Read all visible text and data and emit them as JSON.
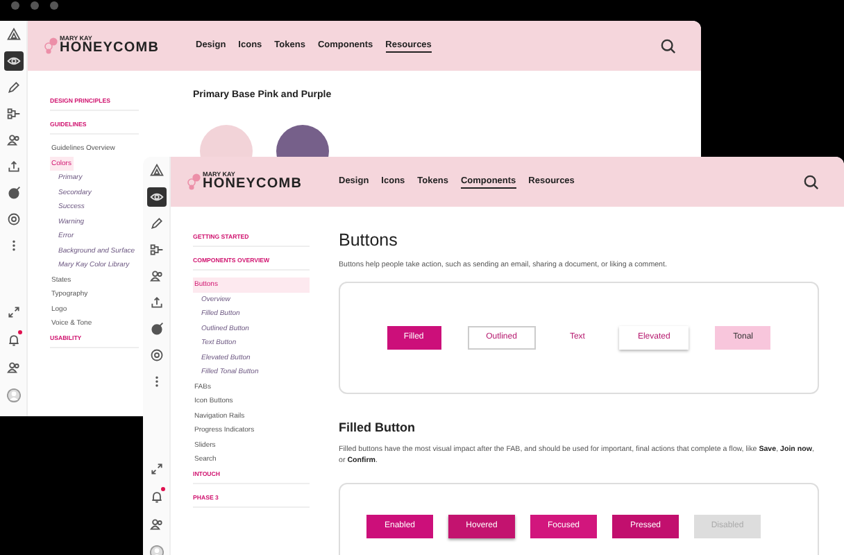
{
  "windows": [
    {
      "rail": {
        "top": [
          {
            "kind": "logo",
            "selected": false,
            "badge": false
          },
          {
            "kind": "eye",
            "selected": true,
            "badge": false
          },
          {
            "kind": "pencil",
            "selected": false,
            "badge": false
          },
          {
            "kind": "flow",
            "selected": false,
            "badge": false
          },
          {
            "kind": "people",
            "selected": false,
            "badge": false
          },
          {
            "kind": "upload",
            "selected": false,
            "badge": false
          },
          {
            "kind": "target",
            "selected": false,
            "badge": false
          },
          {
            "kind": "gear",
            "selected": false,
            "badge": false
          },
          {
            "kind": "more",
            "selected": false,
            "badge": false
          }
        ],
        "bottom": [
          {
            "kind": "expand",
            "selected": false,
            "badge": false
          },
          {
            "kind": "bell",
            "selected": false,
            "badge": true
          },
          {
            "kind": "people",
            "selected": false,
            "badge": false
          },
          {
            "kind": "avatar",
            "selected": false,
            "badge": false
          }
        ]
      },
      "logo": {
        "brand": "MARY KAY",
        "name": "HONEYCOMB"
      },
      "nav": [
        {
          "label": "Design",
          "selected": false
        },
        {
          "label": "Icons",
          "selected": false
        },
        {
          "label": "Tokens",
          "selected": false
        },
        {
          "label": "Components",
          "selected": false
        },
        {
          "label": "Resources",
          "selected": true
        }
      ],
      "sidebar": [
        {
          "kind": "heading",
          "label": "DESIGN PRINCIPLES",
          "selected": false
        },
        {
          "kind": "heading",
          "label": "GUIDELINES",
          "selected": false
        },
        {
          "kind": "item",
          "label": "Guidelines Overview",
          "selected": false
        },
        {
          "kind": "item",
          "label": "Colors",
          "selected": true
        },
        {
          "kind": "subitem",
          "label": "Primary",
          "selected": false
        },
        {
          "kind": "subitem",
          "label": "Secondary",
          "selected": false
        },
        {
          "kind": "subitem",
          "label": "Success",
          "selected": false
        },
        {
          "kind": "subitem",
          "label": "Warning",
          "selected": false
        },
        {
          "kind": "subitem",
          "label": "Error",
          "selected": false
        },
        {
          "kind": "subitem",
          "label": "Background and Surface",
          "selected": false
        },
        {
          "kind": "subitem",
          "label": "Mary Kay Color Library",
          "selected": false
        },
        {
          "kind": "item",
          "label": "States",
          "selected": false
        },
        {
          "kind": "item",
          "label": "Typography",
          "selected": false
        },
        {
          "kind": "item",
          "label": "Logo",
          "selected": false
        },
        {
          "kind": "item",
          "label": "Voice & Tone",
          "selected": false
        },
        {
          "kind": "heading",
          "label": "USABILITY",
          "selected": false
        }
      ],
      "content": {
        "kind": "swatches",
        "title": "Primary  Base Pink and Purple",
        "swatches": [
          {
            "color": "#f2d3d8"
          },
          {
            "color": "#76608a"
          }
        ]
      }
    },
    {
      "rail": {
        "top": [
          {
            "kind": "logo",
            "selected": false,
            "badge": false
          },
          {
            "kind": "eye",
            "selected": true,
            "badge": false
          },
          {
            "kind": "pencil",
            "selected": false,
            "badge": false
          },
          {
            "kind": "flow",
            "selected": false,
            "badge": false
          },
          {
            "kind": "people",
            "selected": false,
            "badge": false
          },
          {
            "kind": "upload",
            "selected": false,
            "badge": false
          },
          {
            "kind": "target",
            "selected": false,
            "badge": false
          },
          {
            "kind": "gear",
            "selected": false,
            "badge": false
          },
          {
            "kind": "more",
            "selected": false,
            "badge": false
          }
        ],
        "bottom": [
          {
            "kind": "expand",
            "selected": false,
            "badge": false
          },
          {
            "kind": "bell",
            "selected": false,
            "badge": true
          },
          {
            "kind": "people",
            "selected": false,
            "badge": false
          },
          {
            "kind": "avatar",
            "selected": false,
            "badge": false
          }
        ]
      },
      "logo": {
        "brand": "MARY KAY",
        "name": "HONEYCOMB"
      },
      "nav": [
        {
          "label": "Design",
          "selected": false
        },
        {
          "label": "Icons",
          "selected": false
        },
        {
          "label": "Tokens",
          "selected": false
        },
        {
          "label": "Components",
          "selected": true
        },
        {
          "label": "Resources",
          "selected": false
        }
      ],
      "sidebar": [
        {
          "kind": "heading",
          "label": "GETTING STARTED",
          "selected": false
        },
        {
          "kind": "heading",
          "label": "COMPONENTS OVERVIEW",
          "selected": false
        },
        {
          "kind": "item",
          "label": "Buttons",
          "selected": true
        },
        {
          "kind": "subitem",
          "label": "Overview",
          "selected": false
        },
        {
          "kind": "subitem",
          "label": "Filled Button",
          "selected": false
        },
        {
          "kind": "subitem",
          "label": "Outlined Button",
          "selected": false
        },
        {
          "kind": "subitem",
          "label": "Text Button",
          "selected": false
        },
        {
          "kind": "subitem",
          "label": "Elevated Button",
          "selected": false
        },
        {
          "kind": "subitem",
          "label": "Filled Tonal Button",
          "selected": false
        },
        {
          "kind": "item",
          "label": "FABs",
          "selected": false
        },
        {
          "kind": "item",
          "label": "Icon Buttons",
          "selected": false
        },
        {
          "kind": "item",
          "label": "Navigation Rails",
          "selected": false
        },
        {
          "kind": "item",
          "label": "Progress Indicators",
          "selected": false
        },
        {
          "kind": "item",
          "label": "Sliders",
          "selected": false
        },
        {
          "kind": "item",
          "label": "Search",
          "selected": false
        },
        {
          "kind": "heading",
          "label": "INTOUCH",
          "selected": false
        },
        {
          "kind": "heading",
          "label": "PHASE 3",
          "selected": false
        }
      ],
      "content": {
        "kind": "buttons",
        "title": "Buttons",
        "description": "Buttons help people take action, such as sending an email, sharing a document, or liking a comment.",
        "variants": [
          {
            "label": "Filled",
            "kind": "filled"
          },
          {
            "label": "Outlined",
            "kind": "outlined"
          },
          {
            "label": "Text",
            "kind": "text"
          },
          {
            "label": "Elevated",
            "kind": "elevated"
          },
          {
            "label": "Tonal",
            "kind": "tonal"
          }
        ],
        "section_title": "Filled Button",
        "section_text": "Filled buttons have the most visual impact after the FAB, and should be used for important, final actions that complete a flow, like **Save**, **Join now**, or **Confirm**.",
        "states": [
          {
            "label": "Enabled",
            "kind": "enabled"
          },
          {
            "label": "Hovered",
            "kind": "hovered"
          },
          {
            "label": "Focused",
            "kind": "focused"
          },
          {
            "label": "Pressed",
            "kind": "pressed"
          },
          {
            "label": "Disabled",
            "kind": "disabled"
          }
        ]
      }
    }
  ]
}
